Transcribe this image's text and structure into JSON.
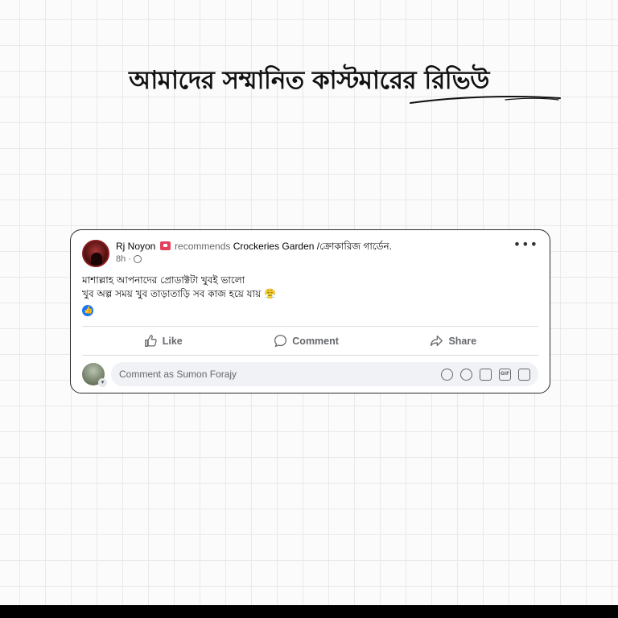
{
  "headline": "আমাদের সম্মানিত কাস্টমারের রিভিউ",
  "post": {
    "author": "Rj Noyon",
    "recommends": "recommends",
    "page_name": "Crockeries Garden /ক্রোকারিজ গার্ডেন.",
    "time": "8h ·",
    "more": "•••",
    "line1": "মাশাল্লাহ আপনাদের প্রোডাক্টটা খুবই ভালো",
    "line2": "খুব অল্প সময় খুব তাড়াতাড়ি সব কাজ হয়ে যায় 😤"
  },
  "actions": {
    "like": "Like",
    "comment": "Comment",
    "share": "Share"
  },
  "comment_input": {
    "placeholder": "Comment as Sumon Forajy"
  },
  "icons": {
    "recommend": "recommend-icon",
    "globe": "globe-icon",
    "like": "thumbs-up-icon",
    "comment": "speech-bubble-icon",
    "share": "share-arrow-icon"
  },
  "colors": {
    "reaction_blue": "#1877f2",
    "recommend_red": "#e4405c"
  }
}
